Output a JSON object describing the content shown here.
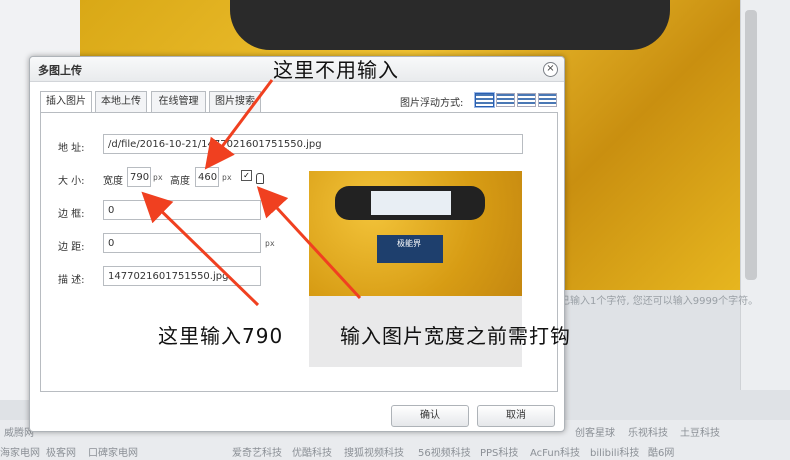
{
  "background": {
    "counter_text": "已输入1个字符, 您还可以输入9999个字符。",
    "footer_links_row1": [
      "威腾网",
      "创客星球",
      "乐视科技",
      "土豆科技"
    ],
    "footer_links_row2": [
      "海家电网",
      "极客网",
      "口碑家电网",
      "爱奇艺科技",
      "优酷科技",
      "搜狐视频科技",
      "56视频科技",
      "PPS科技",
      "AcFun科技",
      "bilibili科技",
      "酷6网"
    ]
  },
  "dialog": {
    "title": "多图上传",
    "close_symbol": "×",
    "tabs": [
      "插入图片",
      "本地上传",
      "在线管理",
      "图片搜索"
    ],
    "active_tab": "插入图片",
    "float_label": "图片浮动方式:",
    "float_icons": [
      "float-none-icon",
      "float-left-icon",
      "float-right-icon",
      "float-center-icon"
    ],
    "form": {
      "address_label": "地  址:",
      "address_value": "/d/file/2016-10-21/1477021601751550.jpg",
      "size_label": "大  小:",
      "width_label": "宽度",
      "width_value": "790",
      "height_label": "高度",
      "height_value": "460",
      "px_unit": "px",
      "lock_checked": true,
      "border_label": "边  框:",
      "border_value": "0",
      "margin_label": "边  距:",
      "margin_value": "0",
      "desc_label": "描  述:",
      "desc_value": "1477021601751550.jpg"
    },
    "preview_card_text": "极能界",
    "buttons": {
      "ok": "确认",
      "cancel": "取消"
    }
  },
  "annotations": {
    "top": "这里不用输入",
    "left": "这里输入790",
    "right": "输入图片宽度之前需打钩"
  },
  "colors": {
    "arrow": "#f04020",
    "panel_border": "#b8bcc1"
  }
}
